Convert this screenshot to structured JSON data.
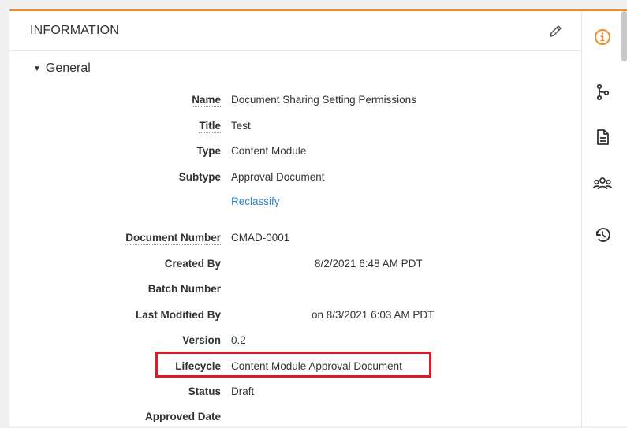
{
  "panel": {
    "title": "INFORMATION",
    "section": "General"
  },
  "fields": {
    "name": {
      "label": "Name",
      "value": "Document Sharing Setting Permissions"
    },
    "title": {
      "label": "Title",
      "value": "Test"
    },
    "type": {
      "label": "Type",
      "value": "Content Module"
    },
    "subtype": {
      "label": "Subtype",
      "value": "Approval Document"
    },
    "reclassify": "Reclassify",
    "document_number": {
      "label": "Document Number",
      "value": "CMAD-0001"
    },
    "created_by": {
      "label": "Created By",
      "value": "8/2/2021 6:48 AM PDT"
    },
    "batch_number": {
      "label": "Batch Number",
      "value": ""
    },
    "last_modified_by": {
      "label": "Last Modified By",
      "value": "on 8/3/2021 6:03 AM PDT"
    },
    "version": {
      "label": "Version",
      "value": "0.2"
    },
    "lifecycle": {
      "label": "Lifecycle",
      "value": "Content Module Approval Document"
    },
    "status": {
      "label": "Status",
      "value": "Draft"
    },
    "approved_date": {
      "label": "Approved Date",
      "value": ""
    }
  },
  "sidebar": {
    "icons": [
      "info-icon",
      "workflow-icon",
      "document-icon",
      "users-icon",
      "history-icon"
    ],
    "accent_color": "#f28c28"
  },
  "colors": {
    "accent": "#f28c28",
    "link": "#2e86c9",
    "highlight": "#e11b22"
  }
}
